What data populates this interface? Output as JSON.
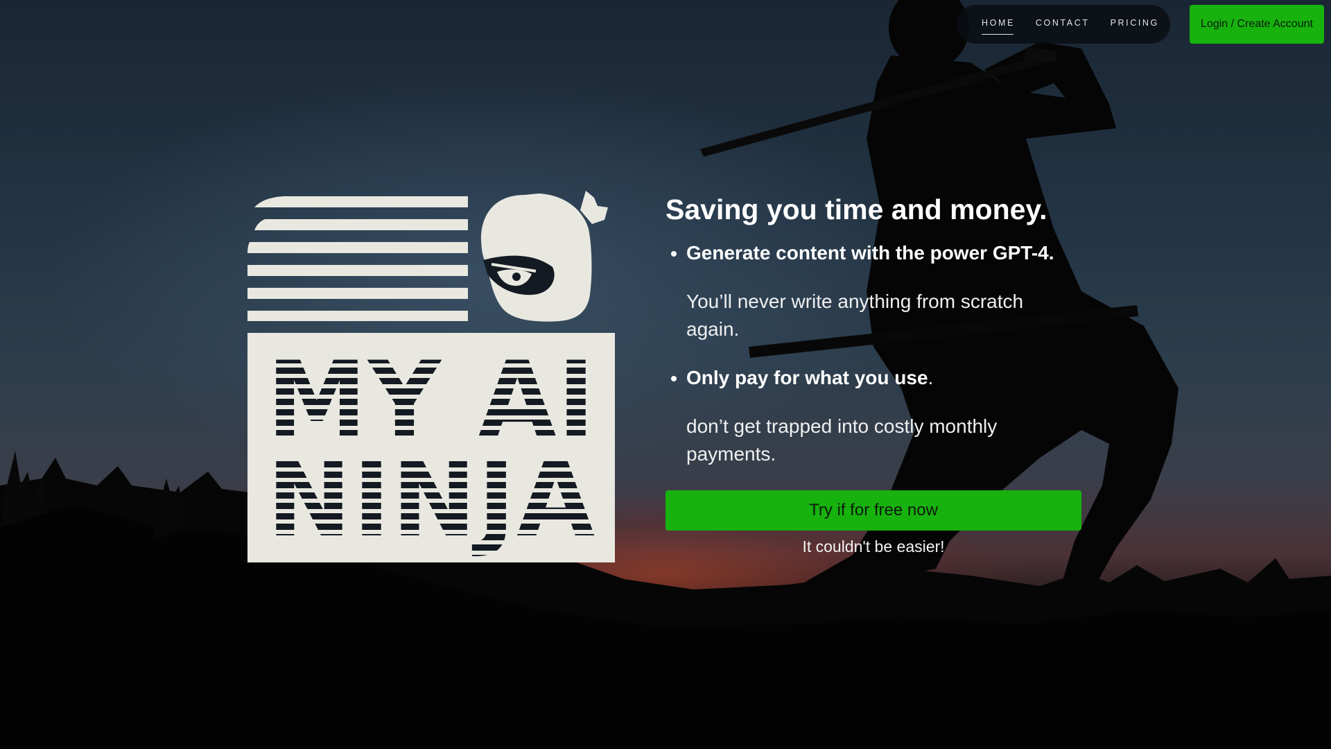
{
  "nav": {
    "items": [
      {
        "label": "HOME",
        "active": true
      },
      {
        "label": "CONTACT",
        "active": false
      },
      {
        "label": "PRICING",
        "active": false
      }
    ],
    "login_label": "Login / Create Account"
  },
  "logo": {
    "line1": "MY AI",
    "line2": "NINJA",
    "icon": "ninja-head-icon"
  },
  "hero": {
    "headline": "Saving you time and money.",
    "features": [
      {
        "title": "Generate content with the power GPT-4.",
        "suffix": "",
        "description": "You’ll never write anything from scratch again."
      },
      {
        "title": "Only pay for what you use",
        "suffix": ".",
        "description": "don’t get trapped into costly monthly payments."
      }
    ],
    "cta_label": "Try if for free now",
    "cta_note": "It couldn't be easier!"
  },
  "colors": {
    "accent_green": "#17b20e",
    "logo_cream": "#e8e8e0",
    "text": "#ffffff"
  }
}
